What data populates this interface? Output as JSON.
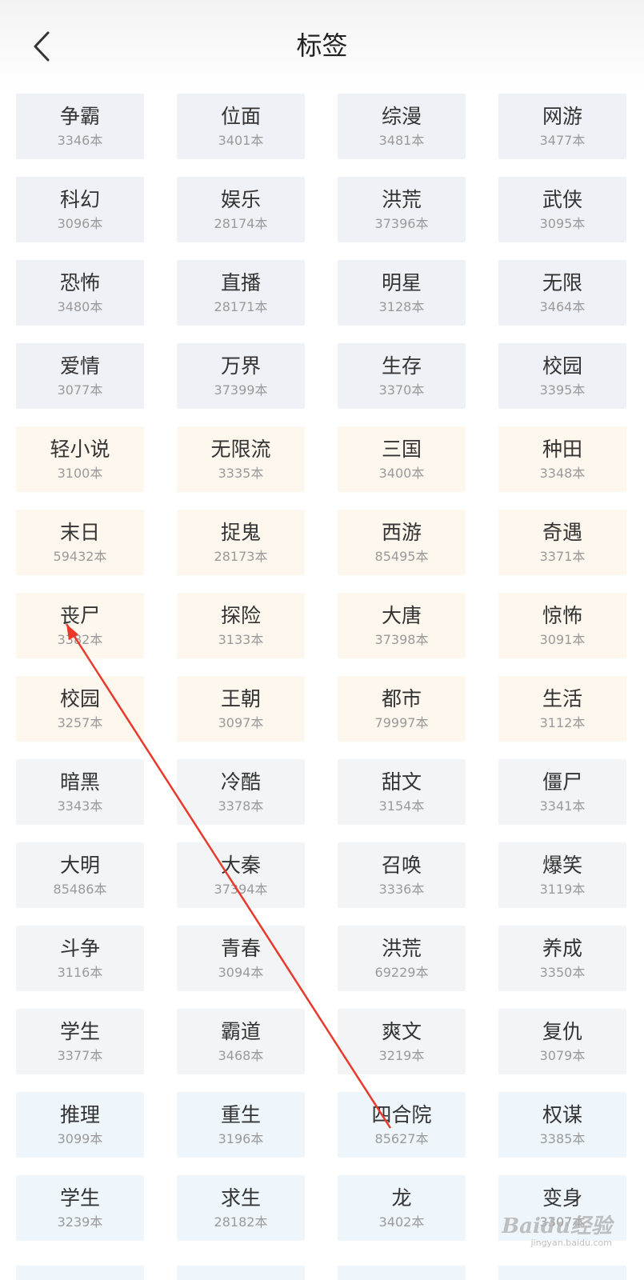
{
  "header": {
    "title": "标签",
    "back_icon": "chevron-left-icon"
  },
  "tags": [
    {
      "name": "争霸",
      "count": "3346本",
      "color": "blue"
    },
    {
      "name": "位面",
      "count": "3401本",
      "color": "blue"
    },
    {
      "name": "综漫",
      "count": "3481本",
      "color": "blue"
    },
    {
      "name": "网游",
      "count": "3477本",
      "color": "blue"
    },
    {
      "name": "科幻",
      "count": "3096本",
      "color": "blue"
    },
    {
      "name": "娱乐",
      "count": "28174本",
      "color": "blue"
    },
    {
      "name": "洪荒",
      "count": "37396本",
      "color": "blue"
    },
    {
      "name": "武侠",
      "count": "3095本",
      "color": "blue"
    },
    {
      "name": "恐怖",
      "count": "3480本",
      "color": "blue"
    },
    {
      "name": "直播",
      "count": "28171本",
      "color": "blue"
    },
    {
      "name": "明星",
      "count": "3128本",
      "color": "blue"
    },
    {
      "name": "无限",
      "count": "3464本",
      "color": "blue"
    },
    {
      "name": "爱情",
      "count": "3077本",
      "color": "blue"
    },
    {
      "name": "万界",
      "count": "37399本",
      "color": "blue"
    },
    {
      "name": "生存",
      "count": "3370本",
      "color": "blue"
    },
    {
      "name": "校园",
      "count": "3395本",
      "color": "blue"
    },
    {
      "name": "轻小说",
      "count": "3100本",
      "color": "cream"
    },
    {
      "name": "无限流",
      "count": "3335本",
      "color": "cream"
    },
    {
      "name": "三国",
      "count": "3400本",
      "color": "cream"
    },
    {
      "name": "种田",
      "count": "3348本",
      "color": "cream"
    },
    {
      "name": "末日",
      "count": "59432本",
      "color": "cream"
    },
    {
      "name": "捉鬼",
      "count": "28173本",
      "color": "cream"
    },
    {
      "name": "西游",
      "count": "85495本",
      "color": "cream"
    },
    {
      "name": "奇遇",
      "count": "3371本",
      "color": "cream"
    },
    {
      "name": "丧尸",
      "count": "3382本",
      "color": "cream"
    },
    {
      "name": "探险",
      "count": "3133本",
      "color": "cream"
    },
    {
      "name": "大唐",
      "count": "37398本",
      "color": "cream"
    },
    {
      "name": "惊怖",
      "count": "3091本",
      "color": "cream"
    },
    {
      "name": "校园",
      "count": "3257本",
      "color": "cream"
    },
    {
      "name": "王朝",
      "count": "3097本",
      "color": "cream"
    },
    {
      "name": "都市",
      "count": "79997本",
      "color": "cream"
    },
    {
      "name": "生活",
      "count": "3112本",
      "color": "cream"
    },
    {
      "name": "暗黑",
      "count": "3343本",
      "color": "gray"
    },
    {
      "name": "冷酷",
      "count": "3378本",
      "color": "gray"
    },
    {
      "name": "甜文",
      "count": "3154本",
      "color": "gray"
    },
    {
      "name": "僵尸",
      "count": "3341本",
      "color": "gray"
    },
    {
      "name": "大明",
      "count": "85486本",
      "color": "gray"
    },
    {
      "name": "大秦",
      "count": "37394本",
      "color": "gray"
    },
    {
      "name": "召唤",
      "count": "3336本",
      "color": "gray"
    },
    {
      "name": "爆笑",
      "count": "3119本",
      "color": "gray"
    },
    {
      "name": "斗争",
      "count": "3116本",
      "color": "gray"
    },
    {
      "name": "青春",
      "count": "3094本",
      "color": "gray"
    },
    {
      "name": "洪荒",
      "count": "69229本",
      "color": "gray"
    },
    {
      "name": "养成",
      "count": "3350本",
      "color": "gray"
    },
    {
      "name": "学生",
      "count": "3377本",
      "color": "gray"
    },
    {
      "name": "霸道",
      "count": "3468本",
      "color": "gray"
    },
    {
      "name": "爽文",
      "count": "3219本",
      "color": "gray"
    },
    {
      "name": "复仇",
      "count": "3079本",
      "color": "gray"
    },
    {
      "name": "推理",
      "count": "3099本",
      "color": "sky"
    },
    {
      "name": "重生",
      "count": "3196本",
      "color": "sky"
    },
    {
      "name": "四合院",
      "count": "85627本",
      "color": "sky"
    },
    {
      "name": "权谋",
      "count": "3385本",
      "color": "sky"
    },
    {
      "name": "学生",
      "count": "3239本",
      "color": "sky"
    },
    {
      "name": "求生",
      "count": "28182本",
      "color": "sky"
    },
    {
      "name": "龙",
      "count": "3402本",
      "color": "sky"
    },
    {
      "name": "变身",
      "count": "3307本",
      "color": "sky"
    }
  ],
  "colors": {
    "blue": "#eef1f6",
    "cream": "#fdf7ee",
    "gray": "#f3f4f6",
    "sky": "#eef6fb",
    "annotation": "#e8392b"
  },
  "watermark": {
    "logo": "Baidu经验",
    "url": "jingyan.baidu.com"
  }
}
